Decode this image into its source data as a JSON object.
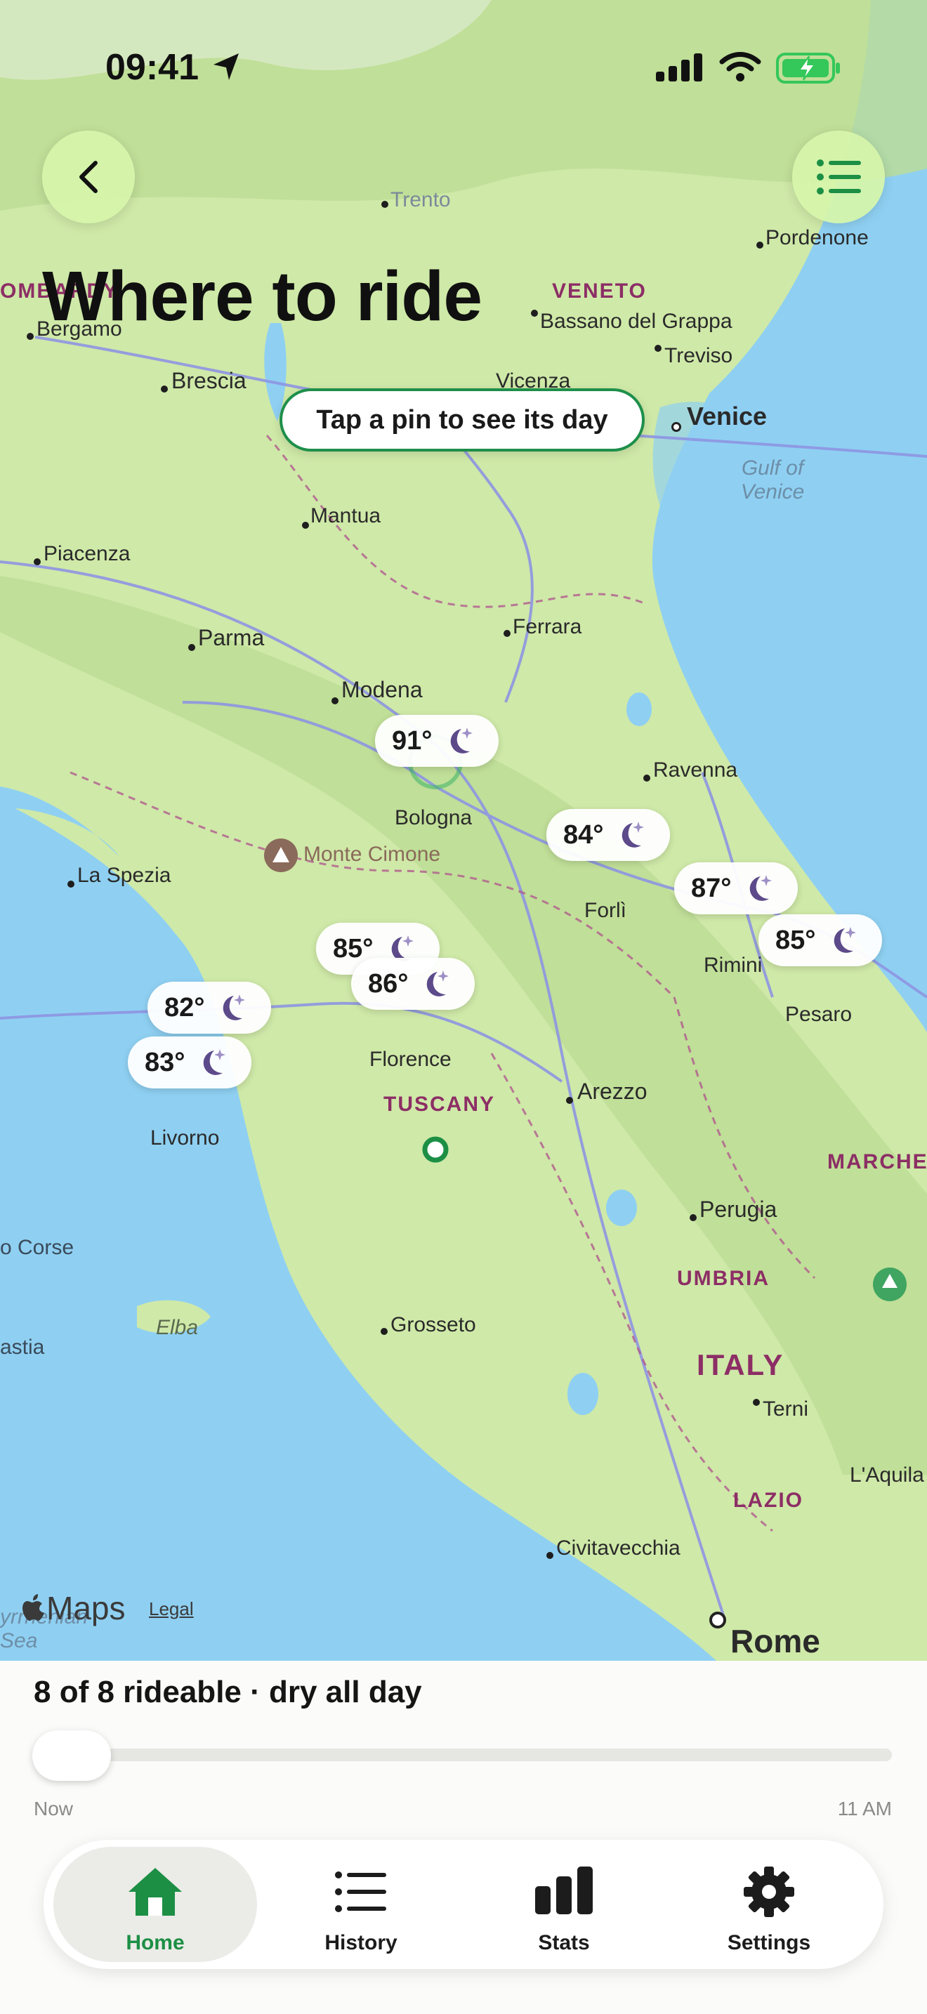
{
  "status_bar": {
    "time": "09:41"
  },
  "header": {
    "title": "Where to ride"
  },
  "map": {
    "hint": "Tap a pin to see its day",
    "brand": "Maps",
    "legal": "Legal",
    "cities": [
      "Trento",
      "Pordenone",
      "Bergamo",
      "Bassano del Grappa",
      "Treviso",
      "Brescia",
      "Vicenza",
      "Venice",
      "Mantua",
      "Piacenza",
      "Ferrara",
      "Parma",
      "Modena",
      "Ravenna",
      "Bologna",
      "La Spezia",
      "Forlì",
      "Rimini",
      "Pesaro",
      "Florence",
      "Arezzo",
      "Livorno",
      "Perugia",
      "Grosseto",
      "Terni",
      "L'Aquila",
      "Civitavecchia",
      "Rome",
      "Monte Cimone"
    ],
    "regions": [
      "OMBARDY",
      "VENETO",
      "TUSCANY",
      "MARCHE",
      "UMBRIA",
      "ITALY",
      "LAZIO"
    ],
    "water": [
      "Gulf of Venice",
      "Elba",
      "o Corse",
      "astia",
      "yrrhenian Sea"
    ],
    "pins": [
      {
        "temp": "91°",
        "icon": "moon-stars-icon"
      },
      {
        "temp": "84°",
        "icon": "moon-stars-icon"
      },
      {
        "temp": "87°",
        "icon": "moon-stars-icon"
      },
      {
        "temp": "85°",
        "icon": "moon-stars-icon"
      },
      {
        "temp": "85°",
        "icon": "moon-stars-icon"
      },
      {
        "temp": "86°",
        "icon": "moon-stars-icon"
      },
      {
        "temp": "82°",
        "icon": "moon-stars-icon"
      },
      {
        "temp": "83°",
        "icon": "moon-stars-icon"
      }
    ]
  },
  "panel": {
    "summary": "8 of 8 rideable · dry all day",
    "slider_start": "Now",
    "slider_end": "11 AM",
    "slider_value": 0
  },
  "tabs": [
    {
      "label": "Home",
      "icon": "house-icon",
      "active": true
    },
    {
      "label": "History",
      "icon": "list-icon",
      "active": false
    },
    {
      "label": "Stats",
      "icon": "bar-chart-icon",
      "active": false
    },
    {
      "label": "Settings",
      "icon": "gear-icon",
      "active": false
    }
  ],
  "colors": {
    "accent": "#1c8f45",
    "land": "#cfe9a8",
    "water": "#8fd0f2",
    "region": "#8c2e65"
  }
}
